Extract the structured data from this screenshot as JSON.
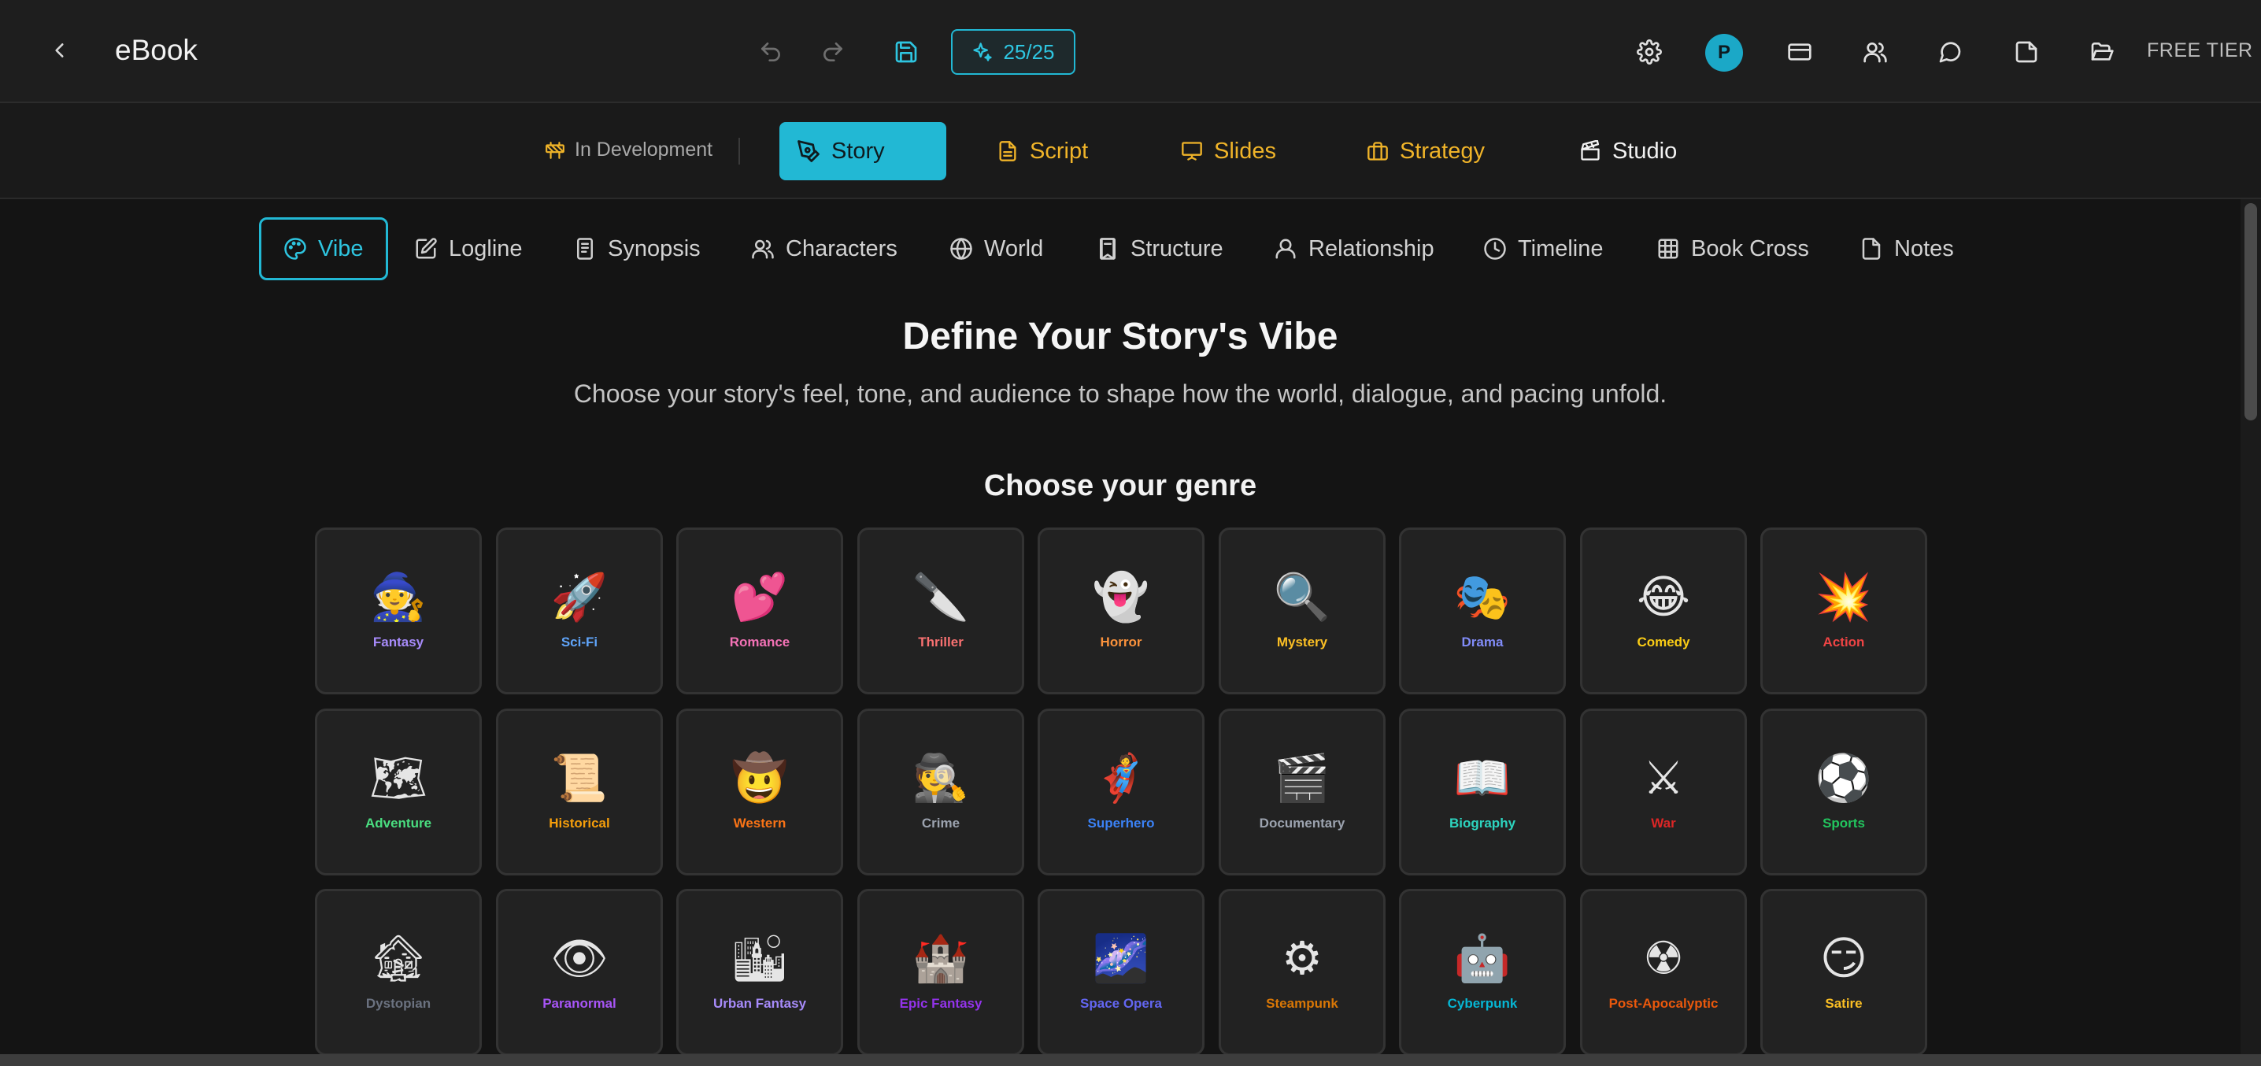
{
  "header": {
    "app_title": "eBook",
    "credits_label": "25/25",
    "avatar_initial": "P",
    "tier_label": "FREE TIER"
  },
  "section_bar": {
    "status_label": "In Development",
    "tabs": [
      {
        "label": "Story",
        "icon": "pen-nib-icon",
        "color": "#0f1a1e"
      },
      {
        "label": "Script",
        "icon": "document-icon",
        "color": "#f0b429"
      },
      {
        "label": "Slides",
        "icon": "presentation-icon",
        "color": "#f0b429"
      },
      {
        "label": "Strategy",
        "icon": "briefcase-icon",
        "color": "#f0b429"
      },
      {
        "label": "Studio",
        "icon": "clapperboard-icon",
        "color": "#f2f2f2"
      }
    ]
  },
  "sub_tabs": [
    {
      "label": "Vibe",
      "icon": "palette-icon"
    },
    {
      "label": "Logline",
      "icon": "edit-icon"
    },
    {
      "label": "Synopsis",
      "icon": "file-text-icon"
    },
    {
      "label": "Characters",
      "icon": "users-icon"
    },
    {
      "label": "World",
      "icon": "globe-icon"
    },
    {
      "label": "Structure",
      "icon": "book-icon"
    },
    {
      "label": "Relationship",
      "icon": "user-icon"
    },
    {
      "label": "Timeline",
      "icon": "clock-icon"
    },
    {
      "label": "Book Cross",
      "icon": "grid-icon"
    },
    {
      "label": "Notes",
      "icon": "note-icon"
    }
  ],
  "main": {
    "title": "Define Your Story's Vibe",
    "subtitle": "Choose your story's feel, tone, and audience to shape how the world, dialogue, and pacing unfold.",
    "genre_heading": "Choose your genre"
  },
  "genres": [
    {
      "label": "Fantasy",
      "emoji": "🧙",
      "color": "#a78bfa"
    },
    {
      "label": "Sci-Fi",
      "emoji": "🚀",
      "color": "#60a5fa"
    },
    {
      "label": "Romance",
      "emoji": "💕",
      "color": "#f472b6"
    },
    {
      "label": "Thriller",
      "emoji": "🔪",
      "color": "#f87171"
    },
    {
      "label": "Horror",
      "emoji": "👻",
      "color": "#fb923c"
    },
    {
      "label": "Mystery",
      "emoji": "🔍",
      "color": "#fbbf24"
    },
    {
      "label": "Drama",
      "emoji": "🎭",
      "color": "#818cf8"
    },
    {
      "label": "Comedy",
      "emoji": "😂",
      "color": "#facc15"
    },
    {
      "label": "Action",
      "emoji": "💥",
      "color": "#ef4444"
    },
    {
      "label": "Adventure",
      "emoji": "🗺",
      "color": "#4ade80"
    },
    {
      "label": "Historical",
      "emoji": "📜",
      "color": "#f59e0b"
    },
    {
      "label": "Western",
      "emoji": "🤠",
      "color": "#f97316"
    },
    {
      "label": "Crime",
      "emoji": "🕵",
      "color": "#9ca3af"
    },
    {
      "label": "Superhero",
      "emoji": "🦸",
      "color": "#3b82f6"
    },
    {
      "label": "Documentary",
      "emoji": "🎬",
      "color": "#9ca3af"
    },
    {
      "label": "Biography",
      "emoji": "📖",
      "color": "#2dd4bf"
    },
    {
      "label": "War",
      "emoji": "⚔",
      "color": "#dc2626"
    },
    {
      "label": "Sports",
      "emoji": "⚽",
      "color": "#22c55e"
    },
    {
      "label": "Dystopian",
      "emoji": "🏚",
      "color": "#6b7280"
    },
    {
      "label": "Paranormal",
      "emoji": "👁",
      "color": "#a855f7"
    },
    {
      "label": "Urban Fantasy",
      "emoji": "🏙",
      "color": "#a78bfa"
    },
    {
      "label": "Epic Fantasy",
      "emoji": "🏰",
      "color": "#9333ea"
    },
    {
      "label": "Space Opera",
      "emoji": "🌌",
      "color": "#6366f1"
    },
    {
      "label": "Steampunk",
      "emoji": "⚙",
      "color": "#d97706"
    },
    {
      "label": "Cyberpunk",
      "emoji": "🤖",
      "color": "#06b6d4"
    },
    {
      "label": "Post-Apocalyptic",
      "emoji": "☢",
      "color": "#ea580c"
    },
    {
      "label": "Satire",
      "emoji": "😏",
      "color": "#fbbf24"
    }
  ]
}
